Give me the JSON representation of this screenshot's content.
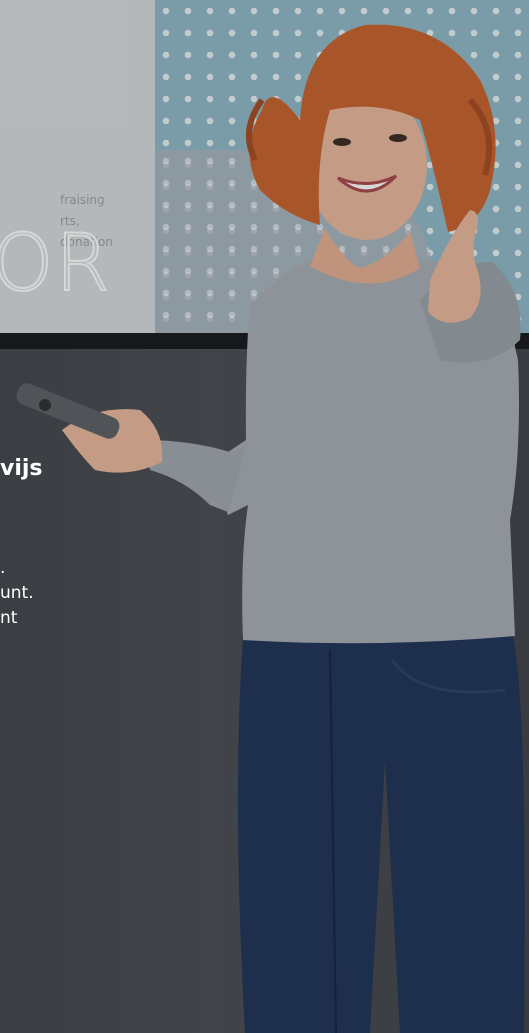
{
  "screen": {
    "big_text": "OR",
    "faded_lines": [
      "fraising",
      "rts, donation"
    ]
  },
  "overlay": {
    "heading": "vijs",
    "paragraph_lines": [
      ".",
      "unt.",
      "nt"
    ]
  },
  "colors": {
    "hair": "#c8612c",
    "shirt": "#a7adb3",
    "jeans": "#1f3157",
    "skin": "#e9b79b"
  }
}
